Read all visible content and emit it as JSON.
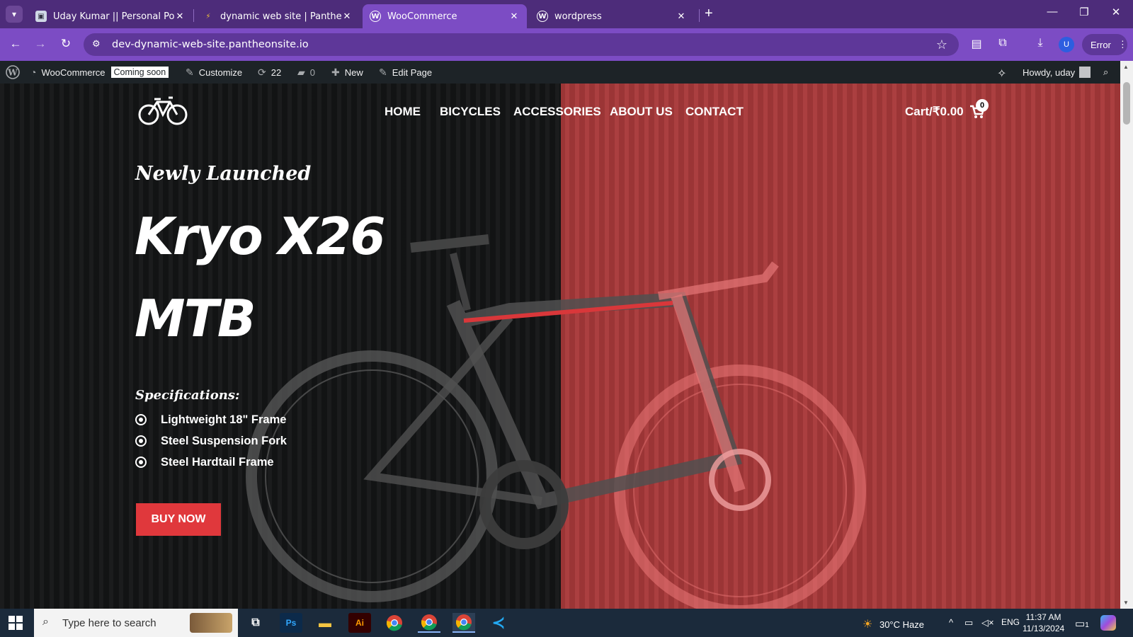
{
  "browser": {
    "tabs": [
      {
        "title": "Uday Kumar || Personal Portfolio"
      },
      {
        "title": "dynamic web site | Pantheon Dashboard"
      },
      {
        "title": "WooCommerce"
      },
      {
        "title": "wordpress"
      }
    ],
    "url": "dev-dynamic-web-site.pantheonsite.io",
    "profile_initial": "U",
    "error_label": "Error"
  },
  "admin_bar": {
    "site_name": "WooCommerce",
    "coming_soon": "Coming soon",
    "customize": "Customize",
    "updates": "22",
    "comments": "0",
    "new": "New",
    "edit_page": "Edit Page",
    "howdy": "Howdy, uday"
  },
  "site": {
    "nav": [
      "HOME",
      "BICYCLES",
      "ACCESSORIES",
      "ABOUT US",
      "CONTACT"
    ],
    "cart_label": "Cart/₹0.00",
    "cart_count": "0",
    "accent": "#e0383c",
    "overlay_color": "#a8393a"
  },
  "hero": {
    "kicker": "Newly Launched",
    "title_line1": "Kryo X26",
    "title_line2": "MTB",
    "spec_heading": "Specifications:",
    "specs": [
      "Lightweight 18\" Frame",
      "Steel Suspension Fork",
      "Steel Hardtail Frame"
    ],
    "cta": "BUY NOW"
  },
  "taskbar": {
    "search_placeholder": "Type here to search",
    "weather": "30°C  Haze",
    "language": "ENG",
    "time": "11:37 AM",
    "date": "11/13/2024",
    "notification_count": "1"
  }
}
